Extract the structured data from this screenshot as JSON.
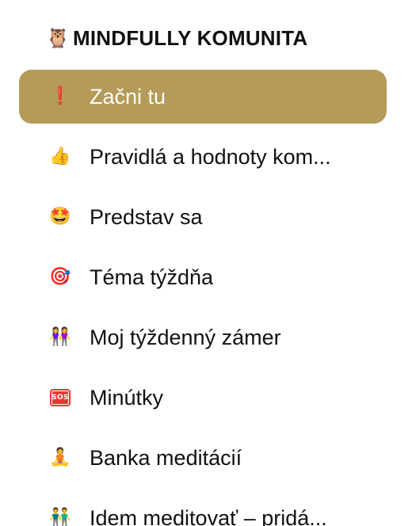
{
  "header": {
    "icon": "owl-icon",
    "emoji": "🦉",
    "title": "MINDFULLY KOMUNITA"
  },
  "colors": {
    "active_bg": "#b49b5a",
    "active_text": "#ffffff",
    "text": "#111111"
  },
  "nav": {
    "items": [
      {
        "icon": "exclamation-icon",
        "emoji": "❗",
        "label": "Začni tu",
        "active": true
      },
      {
        "icon": "thumbs-up-icon",
        "emoji": "👍",
        "label": "Pravidlá a hodnoty kom...",
        "active": false
      },
      {
        "icon": "star-struck-icon",
        "emoji": "🤩",
        "label": "Predstav sa",
        "active": false
      },
      {
        "icon": "target-icon",
        "emoji": "🎯",
        "label": "Téma týždňa",
        "active": false
      },
      {
        "icon": "two-women-icon",
        "emoji": "👭",
        "label": "Moj týždenný zámer",
        "active": false
      },
      {
        "icon": "sos-icon",
        "emoji": "SOS",
        "label": "Minútky",
        "active": false
      },
      {
        "icon": "meditation-icon",
        "emoji": "🧘",
        "label": "Banka meditácií",
        "active": false
      },
      {
        "icon": "two-men-icon",
        "emoji": "👬",
        "label": "Idem meditovať – pridá...",
        "active": false
      }
    ]
  }
}
